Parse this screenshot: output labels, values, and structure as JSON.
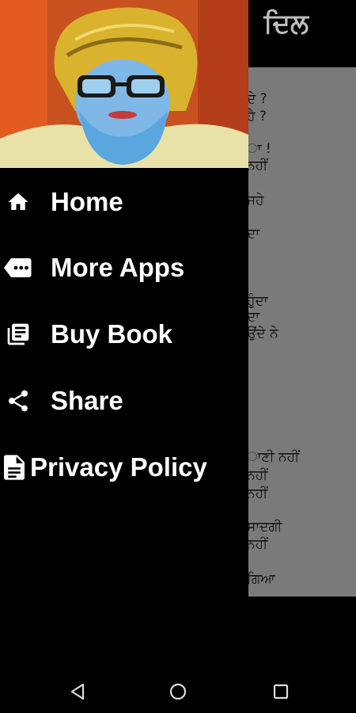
{
  "app": {
    "title": "ਦਿਲ",
    "content_lines": [
      "ਦੇ ?",
      "ਹੈ ?",
      "ਾ !",
      "ਨਹੀਂ",
      "ਜਹੇ",
      "ਦਾ",
      "ਹੁੰਦਾ",
      "ਦਾ",
      "ਉਂਦੇ ਨੇ",
      "ਾਣੀ ਨਹੀਂ",
      "ਨਹੀਂ",
      "ਨਹੀਂ",
      "ਸਾਦਗੀ",
      "ਨਹੀਂ",
      "ਗਿਆ"
    ]
  },
  "drawer": {
    "header_image": "portrait-illustration",
    "items": [
      {
        "label": "Home",
        "icon": "home-icon"
      },
      {
        "label": "More Apps",
        "icon": "more-apps-icon"
      },
      {
        "label": "Buy Book",
        "icon": "book-icon"
      },
      {
        "label": "Share",
        "icon": "share-icon"
      },
      {
        "label": "Privacy Policy",
        "icon": "document-icon"
      }
    ]
  },
  "navbar": {
    "back": "back-icon",
    "home": "home-circle-icon",
    "recents": "recents-icon"
  },
  "colors": {
    "drawer_bg": "#000000",
    "content_bg": "#7a7a7a",
    "text": "#ffffff"
  }
}
